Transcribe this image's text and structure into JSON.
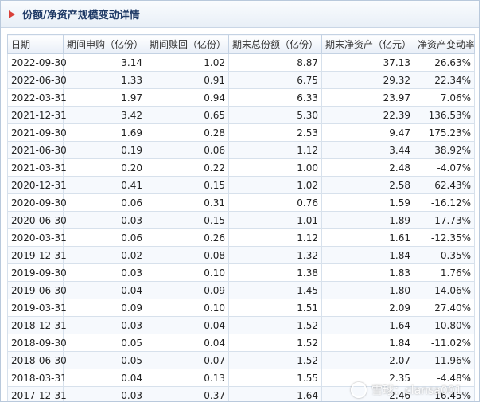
{
  "panel": {
    "title": "份额/净资产规模变动详情",
    "icon": "red-triangle-bullet-icon"
  },
  "table": {
    "headers": [
      "日期",
      "期间申购（亿份）",
      "期间赎回（亿份）",
      "期末总份额（亿份）",
      "期末净资产（亿元）",
      "净资产变动率"
    ],
    "rows": [
      [
        "2022-09-30",
        "3.14",
        "1.02",
        "8.87",
        "37.13",
        "26.63%"
      ],
      [
        "2022-06-30",
        "1.33",
        "0.91",
        "6.75",
        "29.32",
        "22.34%"
      ],
      [
        "2022-03-31",
        "1.97",
        "0.94",
        "6.33",
        "23.97",
        "7.06%"
      ],
      [
        "2021-12-31",
        "3.42",
        "0.65",
        "5.30",
        "22.39",
        "136.53%"
      ],
      [
        "2021-09-30",
        "1.69",
        "0.28",
        "2.53",
        "9.47",
        "175.23%"
      ],
      [
        "2021-06-30",
        "0.19",
        "0.06",
        "1.12",
        "3.44",
        "38.92%"
      ],
      [
        "2021-03-31",
        "0.20",
        "0.22",
        "1.00",
        "2.48",
        "-4.07%"
      ],
      [
        "2020-12-31",
        "0.41",
        "0.15",
        "1.02",
        "2.58",
        "62.43%"
      ],
      [
        "2020-09-30",
        "0.06",
        "0.31",
        "0.76",
        "1.59",
        "-16.12%"
      ],
      [
        "2020-06-30",
        "0.03",
        "0.15",
        "1.01",
        "1.89",
        "17.73%"
      ],
      [
        "2020-03-31",
        "0.06",
        "0.26",
        "1.12",
        "1.61",
        "-12.35%"
      ],
      [
        "2019-12-31",
        "0.02",
        "0.08",
        "1.32",
        "1.84",
        "0.35%"
      ],
      [
        "2019-09-30",
        "0.03",
        "0.10",
        "1.38",
        "1.83",
        "1.76%"
      ],
      [
        "2019-06-30",
        "0.04",
        "0.09",
        "1.45",
        "1.80",
        "-14.06%"
      ],
      [
        "2019-03-31",
        "0.09",
        "0.10",
        "1.51",
        "2.09",
        "27.40%"
      ],
      [
        "2018-12-31",
        "0.03",
        "0.04",
        "1.52",
        "1.64",
        "-10.80%"
      ],
      [
        "2018-09-30",
        "0.05",
        "0.04",
        "1.52",
        "1.84",
        "-11.02%"
      ],
      [
        "2018-06-30",
        "0.05",
        "0.07",
        "1.52",
        "2.07",
        "-11.96%"
      ],
      [
        "2018-03-31",
        "0.04",
        "0.13",
        "1.55",
        "2.35",
        "-4.48%"
      ],
      [
        "2017-12-31",
        "0.03",
        "0.37",
        "1.64",
        "2.46",
        "-16.45%"
      ]
    ]
  },
  "watermark": {
    "text": "雪球：clansa001",
    "icon": "xueqiu-logo-icon"
  }
}
